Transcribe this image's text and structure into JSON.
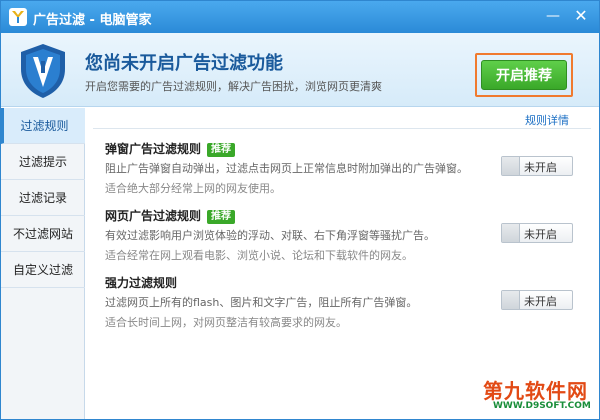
{
  "window": {
    "title": "广告过滤 - 电脑管家",
    "minimize_glyph": "—",
    "close_glyph": "✕"
  },
  "header": {
    "title": "您尚未开启广告过滤功能",
    "subtitle": "开启您需要的广告过滤规则，解决广告困扰，浏览网页更清爽",
    "cta_label": "开启推荐",
    "icon": "shield-icon"
  },
  "sidebar": {
    "items": [
      {
        "label": "过滤规则",
        "active": true
      },
      {
        "label": "过滤提示",
        "active": false
      },
      {
        "label": "过滤记录",
        "active": false
      },
      {
        "label": "不过滤网站",
        "active": false
      },
      {
        "label": "自定义过滤",
        "active": false
      }
    ]
  },
  "content": {
    "details_link": "规则详情",
    "sections": [
      {
        "title": "弹窗广告过滤规则",
        "badge": "推荐",
        "desc1": "阻止广告弹窗自动弹出，过滤点击网页上正常信息时附加弹出的广告弹窗。",
        "desc2": "适合绝大部分经常上网的网友使用。",
        "toggle": "未开启"
      },
      {
        "title": "网页广告过滤规则",
        "badge": "推荐",
        "desc1": "有效过滤影响用户浏览体验的浮动、对联、右下角浮窗等骚扰广告。",
        "desc2": "适合经常在网上观看电影、浏览小说、论坛和下载软件的网友。",
        "toggle": "未开启"
      },
      {
        "title": "强力过滤规则",
        "badge": "",
        "desc1": "过滤网页上所有的flash、图片和文字广告，阻止所有广告弹窗。",
        "desc2": "适合长时间上网，对网页整洁有较高要求的网友。",
        "toggle": "未开启"
      }
    ]
  },
  "watermark": {
    "main": "第九软件网",
    "sub": "WWW.D9SOFT.COM"
  },
  "colors": {
    "titlebar": "#2b8ad7",
    "accent_green": "#3aa829",
    "cta_border": "#f07a2e",
    "link_blue": "#1b6fc4"
  }
}
